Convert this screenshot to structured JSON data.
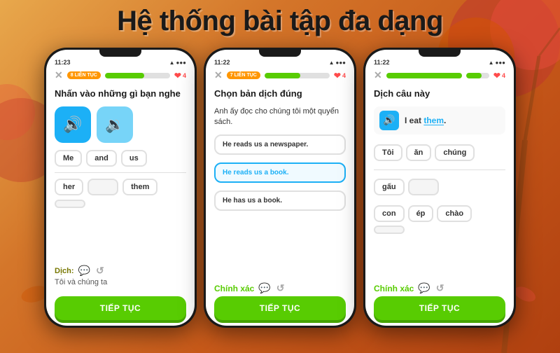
{
  "page": {
    "title": "Hệ thống bài tập đa dạng",
    "bg_colors": [
      "#e8a84c",
      "#b04010"
    ]
  },
  "phone1": {
    "time": "11:23",
    "streak": "8 LIÊN TỤC",
    "progress": 60,
    "hearts": "4",
    "exercise_type": "Nhấn vào những gì bạn nghe",
    "words_top": [
      "Me",
      "and",
      "us"
    ],
    "words_bottom": [
      "her",
      "",
      "them",
      ""
    ],
    "translate_label": "Dịch:",
    "translate_text": "Tôi và chúng ta",
    "continue_btn": "TIẾP TỤC"
  },
  "phone2": {
    "time": "11:22",
    "streak": "7 LIÊN TỤC",
    "progress": 55,
    "hearts": "4",
    "exercise_type": "Chọn bản dịch đúng",
    "question": "Anh ấy đọc cho chúng tôi một quyển sách.",
    "options": [
      {
        "text": "He reads us a newspaper.",
        "selected": false
      },
      {
        "text": "He reads us a book.",
        "selected": true
      },
      {
        "text": "He has us a book.",
        "selected": false
      }
    ],
    "correct_label": "Chính xác",
    "continue_btn": "TIẾP TỤC"
  },
  "phone3": {
    "time": "11:22",
    "streak": "",
    "progress": 65,
    "hearts": "4",
    "exercise_type": "Dịch câu này",
    "sentence": "I eat them.",
    "sentence_highlight": "them",
    "words_top": [
      "Tôi",
      "ăn",
      "chúng"
    ],
    "words_bottom_row1": [
      "gấu",
      ""
    ],
    "words_bottom_row2": [
      "con",
      "ép",
      "chào",
      ""
    ],
    "correct_label": "Chính xác",
    "continue_btn": "TIẾP TỤC"
  },
  "icons": {
    "close": "✕",
    "heart": "❤",
    "sound": "🔊",
    "sound_slow": "🔉",
    "chat": "💬",
    "refresh": "↺"
  }
}
